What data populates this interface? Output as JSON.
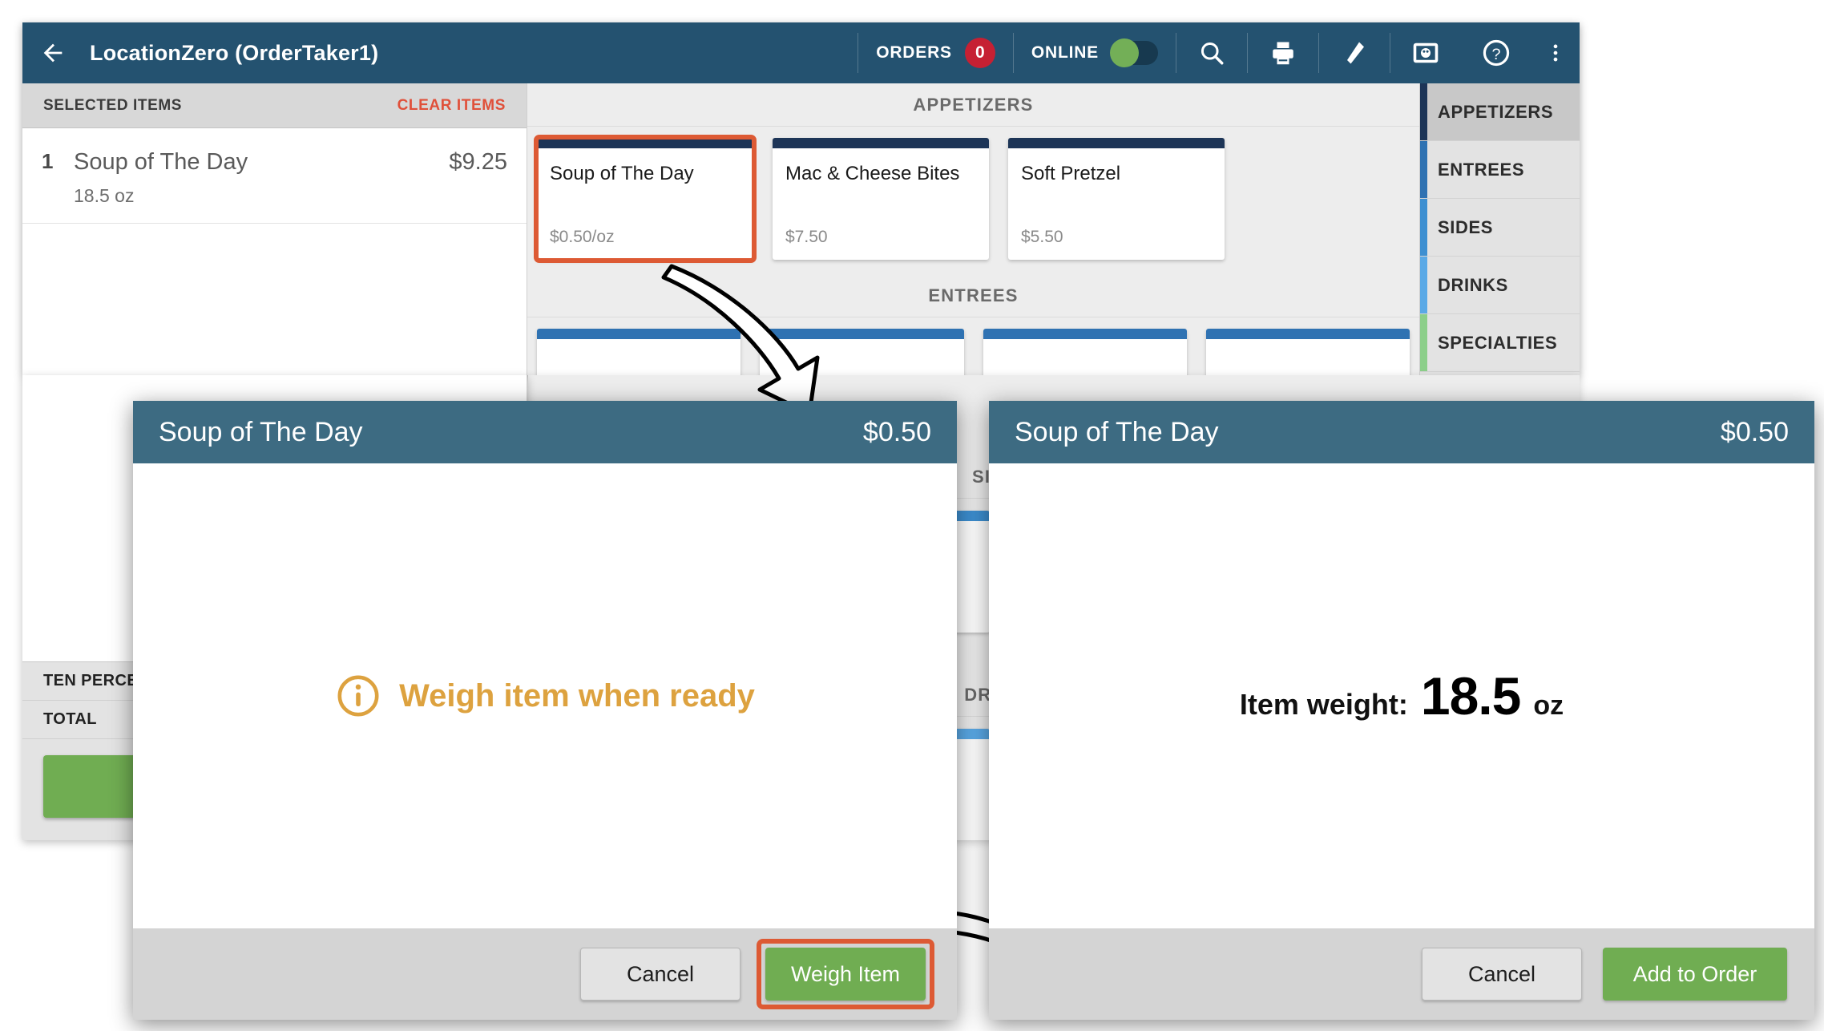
{
  "app": {
    "title": "LocationZero (OrderTaker1)",
    "back_icon": "arrow-left-icon",
    "orders_label": "ORDERS",
    "orders_count": "0",
    "online_label": "ONLINE",
    "icons": [
      "search-icon",
      "printer-icon",
      "tag-icon",
      "terminal-icon",
      "help-icon",
      "overflow-menu-icon"
    ],
    "colors": {
      "app_bar": "#245270",
      "dialog_header": "#3d6b82",
      "primary_green": "#70ad52",
      "highlight_orange": "#dd5a34",
      "badge_red": "#c62033",
      "info_amber": "#dda23f"
    }
  },
  "order_panel": {
    "header_title": "SELECTED ITEMS",
    "clear_label": "CLEAR ITEMS",
    "items": [
      {
        "qty": "1",
        "name": "Soup of The Day",
        "price": "$9.25",
        "detail": "18.5 oz"
      }
    ],
    "totals": [
      {
        "label": "TEN PERCENT"
      },
      {
        "label": "TOTAL"
      }
    ]
  },
  "menu": {
    "sections": [
      {
        "title": "APPETIZERS",
        "strip_color": "#1d3557",
        "items": [
          {
            "name": "Soup of The Day",
            "price": "$0.50/oz",
            "highlighted": true
          },
          {
            "name": "Mac & Cheese Bites",
            "price": "$7.50",
            "highlighted": false
          },
          {
            "name": "Soft Pretzel",
            "price": "$5.50",
            "highlighted": false
          }
        ]
      },
      {
        "title": "ENTREES",
        "strip_color": "#2f72b2",
        "items": [
          {
            "name": "",
            "price": "",
            "highlighted": false
          },
          {
            "name": "",
            "price": "",
            "highlighted": false
          },
          {
            "name": "",
            "price": "",
            "highlighted": false
          },
          {
            "name": "",
            "price": "",
            "highlighted": false
          }
        ]
      },
      {
        "title": "SIDES",
        "strip_color": "#3d8fd1",
        "items": []
      },
      {
        "title": "DRINKS",
        "strip_color": "#5aa9e6",
        "items": []
      }
    ]
  },
  "categories": [
    {
      "label": "APPETIZERS",
      "color": "#1d3557",
      "active": true
    },
    {
      "label": "ENTREES",
      "color": "#2f72b2",
      "active": false
    },
    {
      "label": "SIDES",
      "color": "#3d8fd1",
      "active": false
    },
    {
      "label": "DRINKS",
      "color": "#5aa9e6",
      "active": false
    },
    {
      "label": "SPECIALTIES",
      "color": "#8ccf8a",
      "active": false
    }
  ],
  "dialog_weigh": {
    "title": "Soup of The Day",
    "price": "$0.50",
    "message": "Weigh item when ready",
    "info_icon": "info-circle-icon",
    "cancel_label": "Cancel",
    "confirm_label": "Weigh Item",
    "confirm_highlighted": true
  },
  "dialog_weight": {
    "title": "Soup of The Day",
    "price": "$0.50",
    "weight_label": "Item weight:",
    "weight_value": "18.5",
    "weight_unit": "oz",
    "cancel_label": "Cancel",
    "confirm_label": "Add to Order",
    "confirm_highlighted": false
  }
}
